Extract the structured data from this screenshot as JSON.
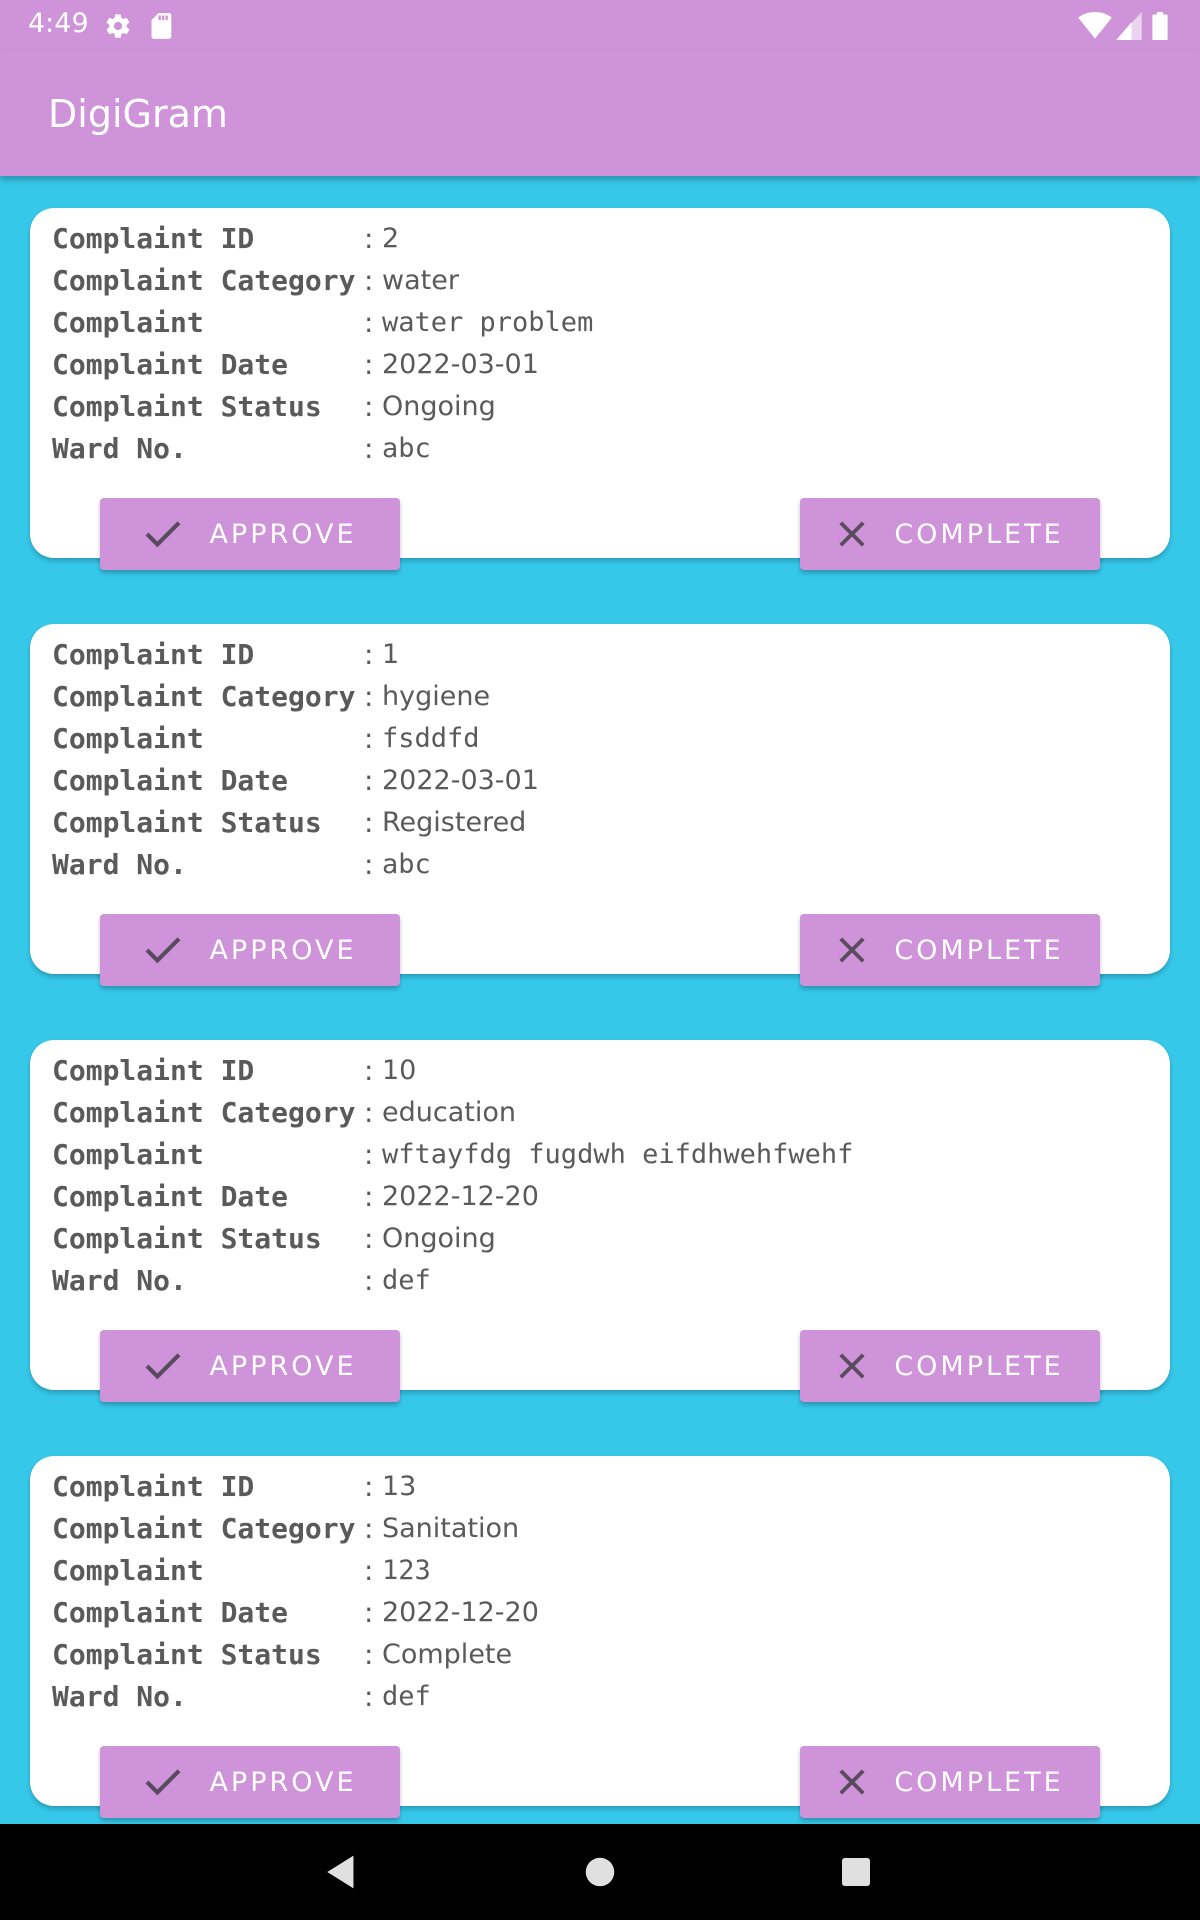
{
  "status_bar": {
    "time": "4:49",
    "icons": [
      "settings-icon",
      "sd-card-icon",
      "wifi-icon",
      "signal-icon",
      "battery-icon"
    ]
  },
  "app_bar": {
    "title": "DigiGram"
  },
  "labels": {
    "complaint_id": "Complaint ID",
    "complaint_category": "Complaint Category",
    "complaint": "Complaint",
    "complaint_date": "Complaint Date",
    "complaint_status": "Complaint Status",
    "ward_no": "Ward No.",
    "separator": ":"
  },
  "buttons": {
    "approve": "APPROVE",
    "complete": "COMPLETE"
  },
  "complaints": [
    {
      "id": "2",
      "category": "water",
      "complaint": "water problem",
      "date": "2022-03-01",
      "status": "Ongoing",
      "ward": "abc"
    },
    {
      "id": "1",
      "category": "hygiene",
      "complaint": "fsddfd",
      "date": "2022-03-01",
      "status": "Registered",
      "ward": "abc"
    },
    {
      "id": "10",
      "category": "education",
      "complaint": "wftayfdg fugdwh eifdhwehfwehf",
      "date": "2022-12-20",
      "status": "Ongoing",
      "ward": "def"
    },
    {
      "id": "13",
      "category": "Sanitation",
      "complaint": "123",
      "date": "2022-12-20",
      "status": "Complete",
      "ward": "def"
    }
  ],
  "colors": {
    "accent": "#ce93d8",
    "background": "#36c8e9",
    "card": "#ffffff",
    "text": "#5a5a5a"
  },
  "nav_bar": {
    "icons": [
      "back-icon",
      "home-icon",
      "recents-icon"
    ]
  }
}
